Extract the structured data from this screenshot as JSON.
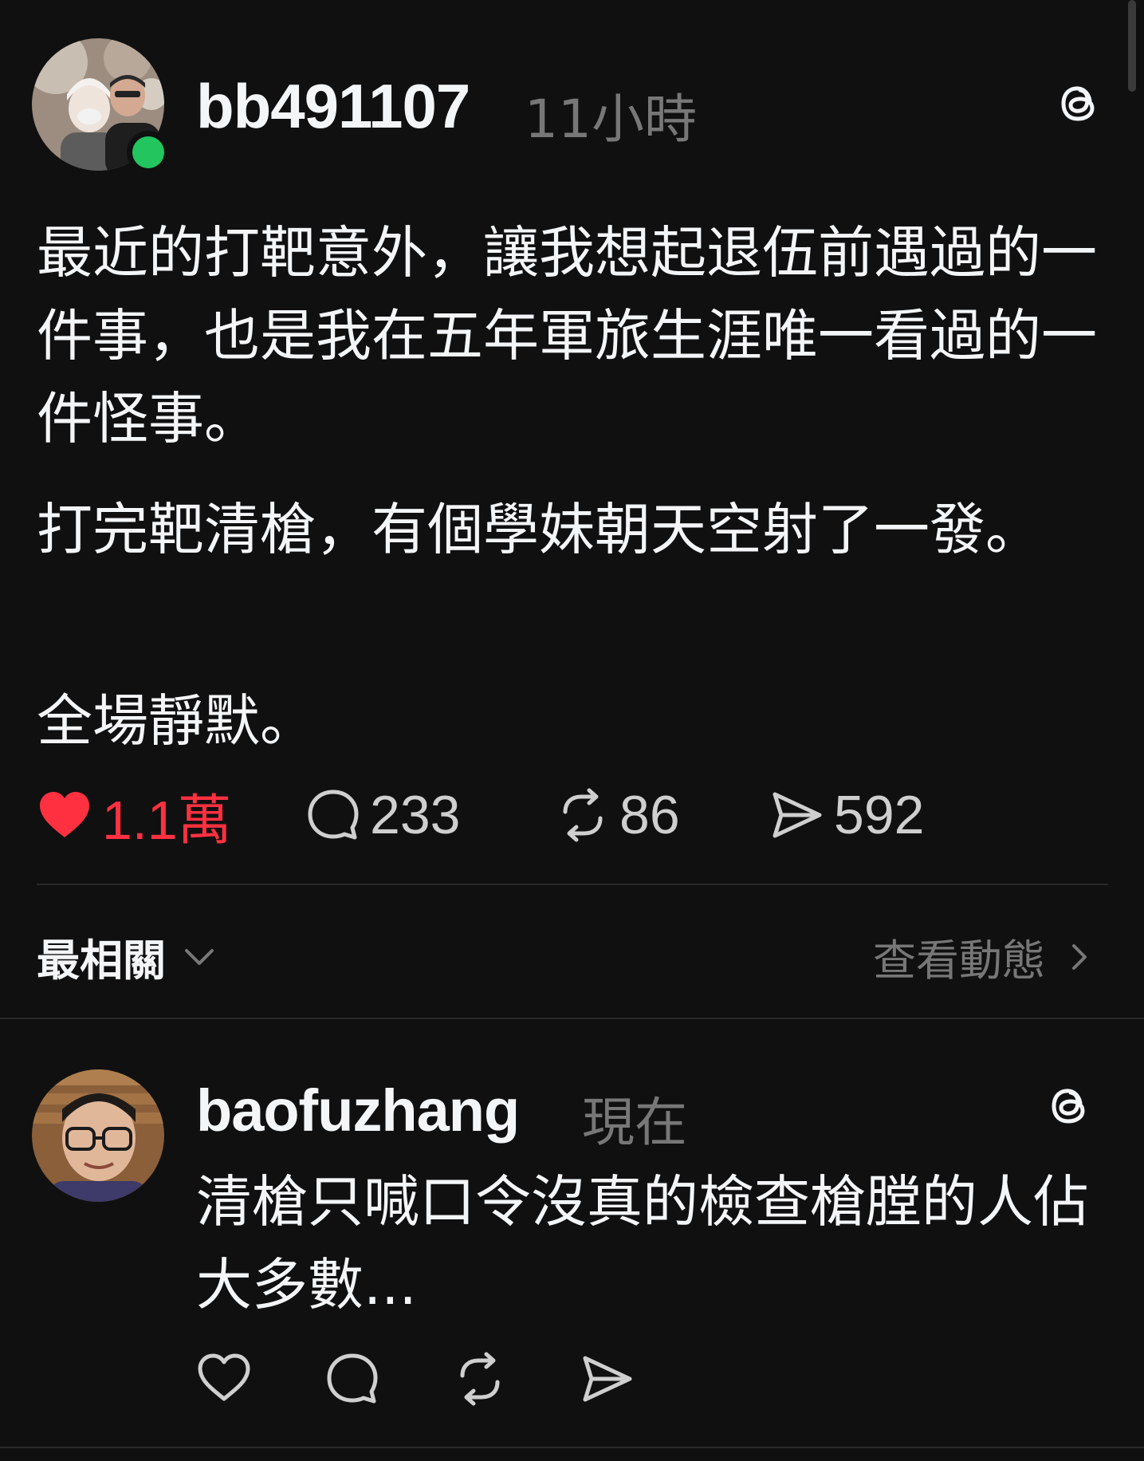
{
  "main_post": {
    "username": "bb491107",
    "time": "11小時",
    "avatar": "couple-selfie-avatar",
    "online": true,
    "paragraphs": [
      "最近的打靶意外，讓我想起退伍前遇過的一件事，也是我在五年軍旅生涯唯一看過的一件怪事。",
      "打完靶清槍，有個學妹朝天空射了一發。",
      "全場靜默。"
    ],
    "actions": {
      "likes": "1.1萬",
      "replies": "233",
      "reposts": "86",
      "shares": "592"
    }
  },
  "sort_bar": {
    "sort_label": "最相關",
    "view_activity_label": "查看動態"
  },
  "reply_post": {
    "username": "baofuzhang",
    "time": "現在",
    "avatar": "man-with-glasses-avatar",
    "text": "清槍只喊口令沒真的檢查槍膛的人佔大多數..."
  },
  "colors": {
    "background": "#101010",
    "text": "#f3f5f7",
    "muted": "#777777",
    "like_active": "#ff3040",
    "online": "#22c55e"
  }
}
